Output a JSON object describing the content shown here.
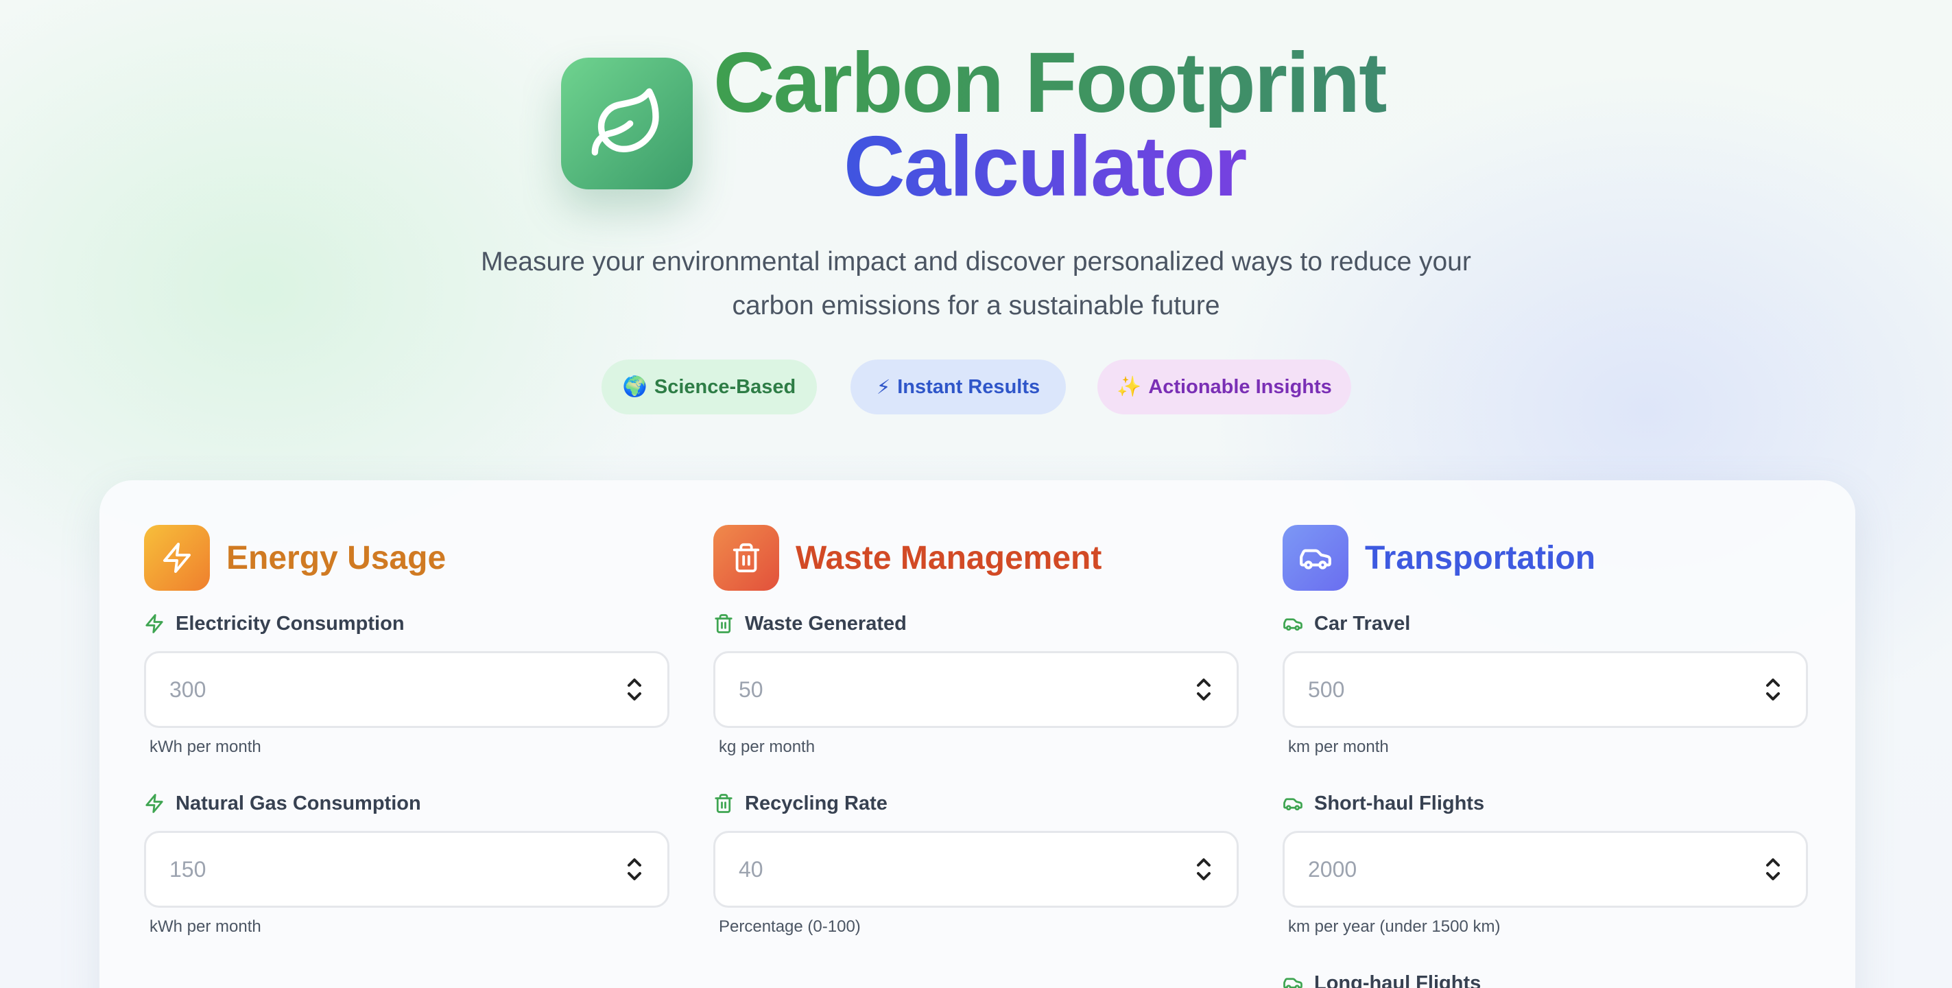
{
  "header": {
    "title_line1": "Carbon Footprint",
    "title_line2": "Calculator",
    "subtitle": "Measure your environmental impact and discover personalized ways to reduce your carbon emissions for a sustainable future",
    "logo_icon": "leaf-icon"
  },
  "badges": [
    {
      "emoji": "🌍",
      "label": "Science-Based"
    },
    {
      "emoji": "⚡",
      "label": "Instant Results"
    },
    {
      "emoji": "✨",
      "label": "Actionable Insights"
    }
  ],
  "sections": {
    "energy": {
      "title": "Energy Usage",
      "icon": "lightning-icon",
      "fields": [
        {
          "label": "Electricity Consumption",
          "placeholder": "300",
          "hint": "kWh per month"
        },
        {
          "label": "Natural Gas Consumption",
          "placeholder": "150",
          "hint": "kWh per month"
        }
      ]
    },
    "waste": {
      "title": "Waste Management",
      "icon": "trash-icon",
      "fields": [
        {
          "label": "Waste Generated",
          "placeholder": "50",
          "hint": "kg per month"
        },
        {
          "label": "Recycling Rate",
          "placeholder": "40",
          "hint": "Percentage (0-100)"
        }
      ]
    },
    "transport": {
      "title": "Transportation",
      "icon": "car-icon",
      "fields": [
        {
          "label": "Car Travel",
          "placeholder": "500",
          "hint": "km per month"
        },
        {
          "label": "Short-haul Flights",
          "placeholder": "2000",
          "hint": "km per year (under 1500 km)"
        },
        {
          "label": "Long-haul Flights"
        }
      ]
    }
  },
  "colors": {
    "green": "#3f9f4f",
    "blue": "#3f55e0",
    "purple": "#7c3fe0",
    "energy": "#d07a22",
    "waste": "#d24a25",
    "transport": "#3e5ae0"
  }
}
